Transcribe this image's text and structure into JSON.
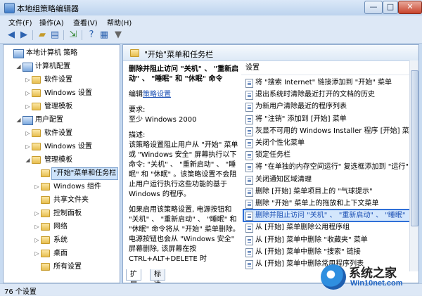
{
  "window": {
    "title": "本地组策略编辑器"
  },
  "window_buttons": {
    "minimize": "—",
    "maximize": "□",
    "close": "✕"
  },
  "menu": [
    "文件(F)",
    "操作(A)",
    "查看(V)",
    "帮助(H)"
  ],
  "toolbar_icons": [
    "back-arrow-icon",
    "forward-arrow-icon",
    "up-folder-icon",
    "show-hide-tree-icon",
    "export-list-icon",
    "help-icon",
    "properties-icon",
    "filter-icon"
  ],
  "tree": [
    {
      "label": "本地计算机 策略",
      "level": 0,
      "expander": "",
      "icon": "pc"
    },
    {
      "label": "计算机配置",
      "level": 1,
      "expander": "◢",
      "icon": "pc"
    },
    {
      "label": "软件设置",
      "level": 2,
      "expander": "▷",
      "icon": "folder"
    },
    {
      "label": "Windows 设置",
      "level": 2,
      "expander": "▷",
      "icon": "folder"
    },
    {
      "label": "管理模板",
      "level": 2,
      "expander": "▷",
      "icon": "folder"
    },
    {
      "label": "用户配置",
      "level": 1,
      "expander": "◢",
      "icon": "pc"
    },
    {
      "label": "软件设置",
      "level": 2,
      "expander": "▷",
      "icon": "folder"
    },
    {
      "label": "Windows 设置",
      "level": 2,
      "expander": "▷",
      "icon": "folder"
    },
    {
      "label": "管理模板",
      "level": 2,
      "expander": "◢",
      "icon": "folder"
    },
    {
      "label": "\"开始\"菜单和任务栏",
      "level": 3,
      "expander": "",
      "icon": "folder",
      "selected": true
    },
    {
      "label": "Windows 组件",
      "level": 3,
      "expander": "▷",
      "icon": "folder"
    },
    {
      "label": "共享文件夹",
      "level": 3,
      "expander": "",
      "icon": "folder"
    },
    {
      "label": "控制面板",
      "level": 3,
      "expander": "▷",
      "icon": "folder"
    },
    {
      "label": "网络",
      "level": 3,
      "expander": "▷",
      "icon": "folder"
    },
    {
      "label": "系统",
      "level": 3,
      "expander": "▷",
      "icon": "folder"
    },
    {
      "label": "桌面",
      "level": 3,
      "expander": "▷",
      "icon": "folder"
    },
    {
      "label": "所有设置",
      "level": 3,
      "expander": "",
      "icon": "folder"
    }
  ],
  "right_header": "\"开始\"菜单和任务栏",
  "description": {
    "title": "删除并阻止访问 \"关机\" 、 \"重新启动\" 、 \"睡眠\" 和 \"休眠\" 命令",
    "edit_prefix": "编辑",
    "edit_link": "策略设置",
    "requirements_label": "要求:",
    "requirements_value": "至少 Windows 2000",
    "desc_label": "描述:",
    "desc_text": "该策略设置阻止用户从 \"开始\" 菜单或 \"Windows 安全\" 屏幕执行以下命令: \"关机\" 、 \"重新启动\" 、 \"睡眠\" 和 \"休眠\" 。该策略设置不会阻止用户运行执行这些功能的基于 Windows 的程序。",
    "desc_text2": "如果启用该策略设置, 电源按钮和 \"关机\" 、 \"重新启动\" 、 \"睡眠\" 和 \"休眠\" 命令将从 \"开始\" 菜单删除。电源按钮也会从 \"Windows 安全\" 屏幕删除, 该屏幕在按 CTRL+ALT+DELETE 时"
  },
  "list_header": "设置",
  "list": [
    "将 \"搜索 Internet\" 链接添加到 \"开始\" 菜单",
    "退出系统时清除最近打开的文档的历史",
    "为新用户清除最近的程序列表",
    "将 \"注销\" 添加到 [开始] 菜单",
    "灰显不可用的 Windows Installer 程序 [开始] 菜单",
    "关闭个性化菜单",
    "锁定任务栏",
    "将 \"在单独的内存空间运行\" 复选框添加到 \"运行\" 对",
    "关闭通知区域清理",
    "删除 [开始] 菜单项目上的 \"气球提示\"",
    "删除 \"开始\" 菜单上的拖放和上下文菜单",
    "删除并阻止访问 \"关机\" 、 \"重新启动\" 、 \"睡眠\"",
    "从 [开始] 菜单删除公用程序组",
    "从 [开始] 菜单中删除 \"收藏夹\" 菜单",
    "从 [开始] 菜单中删除 \"搜索\" 链接",
    "从 [开始] 菜单中删除常用程序列表"
  ],
  "highlighted_index": 11,
  "tabs": [
    "扩展",
    "标准"
  ],
  "status": "76 个设置",
  "watermark": {
    "cn": "系统之家",
    "url": "Win10net.com"
  }
}
